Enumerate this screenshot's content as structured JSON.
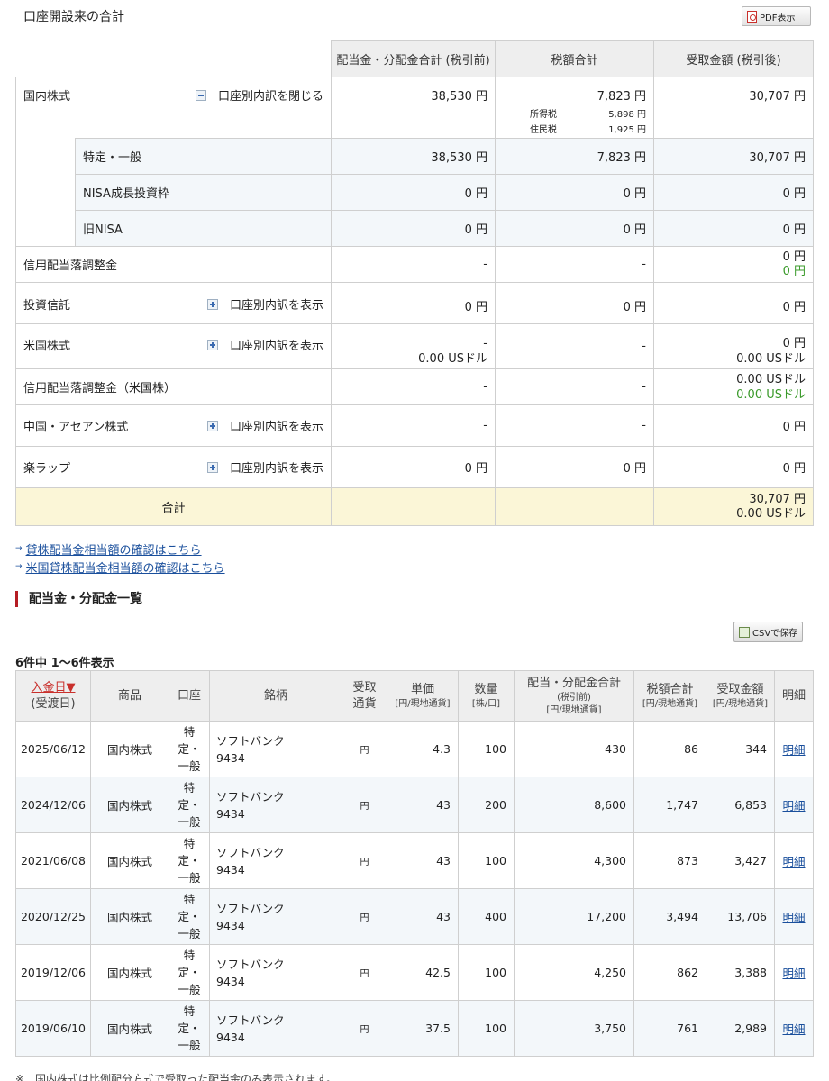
{
  "header": {
    "title": "口座開設来の合計",
    "pdf_label": "PDF表示"
  },
  "summary": {
    "col_headers": [
      "配当金・分配金合計 (税引前)",
      "税額合計",
      "受取金額 (税引後)"
    ],
    "toggle_close": "口座別内訳を閉じる",
    "toggle_open": "口座別内訳を表示",
    "domestic": {
      "label": "国内株式",
      "pretax": "38,530 円",
      "tax": "7,823 円",
      "income_tax_label": "所得税",
      "income_tax": "5,898 円",
      "resident_tax_label": "住民税",
      "resident_tax": "1,925 円",
      "net": "30,707 円"
    },
    "sub_rows": [
      {
        "label": "特定・一般",
        "pretax": "38,530 円",
        "tax": "7,823 円",
        "net": "30,707 円"
      },
      {
        "label": "NISA成長投資枠",
        "pretax": "0 円",
        "tax": "0 円",
        "net": "0 円"
      },
      {
        "label": "旧NISA",
        "pretax": "0 円",
        "tax": "0 円",
        "net": "0 円"
      }
    ],
    "margin_adj": {
      "label": "信用配当落調整金",
      "pretax": "-",
      "tax": "-",
      "net": "0 円",
      "net2": "0 円"
    },
    "fund": {
      "label": "投資信託",
      "pretax": "0 円",
      "tax": "0 円",
      "net": "0 円"
    },
    "us": {
      "label": "米国株式",
      "pretax": "-",
      "pretax2": "0.00 USドル",
      "tax": "-",
      "net": "0 円",
      "net2": "0.00 USドル"
    },
    "us_margin": {
      "label": "信用配当落調整金（米国株）",
      "pretax": "-",
      "tax": "-",
      "net": "0.00 USドル",
      "net2": "0.00 USドル"
    },
    "asean": {
      "label": "中国・アセアン株式",
      "pretax": "-",
      "tax": "-",
      "net": "0 円"
    },
    "wrap": {
      "label": "楽ラップ",
      "pretax": "0 円",
      "tax": "0 円",
      "net": "0 円"
    },
    "total": {
      "label": "合計",
      "net": "30,707 円",
      "net2": "0.00 USドル"
    }
  },
  "links": [
    "貸株配当金相当額の確認はこちら",
    "米国貸株配当金相当額の確認はこちら"
  ],
  "list": {
    "section_title": "配当金・分配金一覧",
    "csv_label": "CSVで保存",
    "count": "6件中 1〜6件表示",
    "headers": {
      "date": "入金日",
      "date_sort": "▼",
      "date_sub": "(受渡日)",
      "product": "商品",
      "account": "口座",
      "name": "銘柄",
      "currency": "受取通貨",
      "price": "単価",
      "price_sub": "[円/現地通貨]",
      "qty": "数量",
      "qty_sub": "[株/口]",
      "pretax": "配当・分配金合計",
      "pretax_sub1": "(税引前)",
      "pretax_sub2": "[円/現地通貨]",
      "tax": "税額合計",
      "tax_sub": "[円/現地通貨]",
      "net": "受取金額",
      "net_sub": "[円/現地通貨]",
      "detail": "明細"
    },
    "rows": [
      {
        "date": "2025/06/12",
        "product": "国内株式",
        "account": "特定・一般",
        "name": "ソフトバンク",
        "code": "9434",
        "currency": "円",
        "price": "4.3",
        "qty": "100",
        "pretax": "430",
        "tax": "86",
        "net": "344",
        "detail": "明細"
      },
      {
        "date": "2024/12/06",
        "product": "国内株式",
        "account": "特定・一般",
        "name": "ソフトバンク",
        "code": "9434",
        "currency": "円",
        "price": "43",
        "qty": "200",
        "pretax": "8,600",
        "tax": "1,747",
        "net": "6,853",
        "detail": "明細"
      },
      {
        "date": "2021/06/08",
        "product": "国内株式",
        "account": "特定・一般",
        "name": "ソフトバンク",
        "code": "9434",
        "currency": "円",
        "price": "43",
        "qty": "100",
        "pretax": "4,300",
        "tax": "873",
        "net": "3,427",
        "detail": "明細"
      },
      {
        "date": "2020/12/25",
        "product": "国内株式",
        "account": "特定・一般",
        "name": "ソフトバンク",
        "code": "9434",
        "currency": "円",
        "price": "43",
        "qty": "400",
        "pretax": "17,200",
        "tax": "3,494",
        "net": "13,706",
        "detail": "明細"
      },
      {
        "date": "2019/12/06",
        "product": "国内株式",
        "account": "特定・一般",
        "name": "ソフトバンク",
        "code": "9434",
        "currency": "円",
        "price": "42.5",
        "qty": "100",
        "pretax": "4,250",
        "tax": "862",
        "net": "3,388",
        "detail": "明細"
      },
      {
        "date": "2019/06/10",
        "product": "国内株式",
        "account": "特定・一般",
        "name": "ソフトバンク",
        "code": "9434",
        "currency": "円",
        "price": "37.5",
        "qty": "100",
        "pretax": "3,750",
        "tax": "761",
        "net": "2,989",
        "detail": "明細"
      }
    ]
  },
  "footnote": "※　国内株式は比例配分方式で受取った配当金のみ表示されます。"
}
